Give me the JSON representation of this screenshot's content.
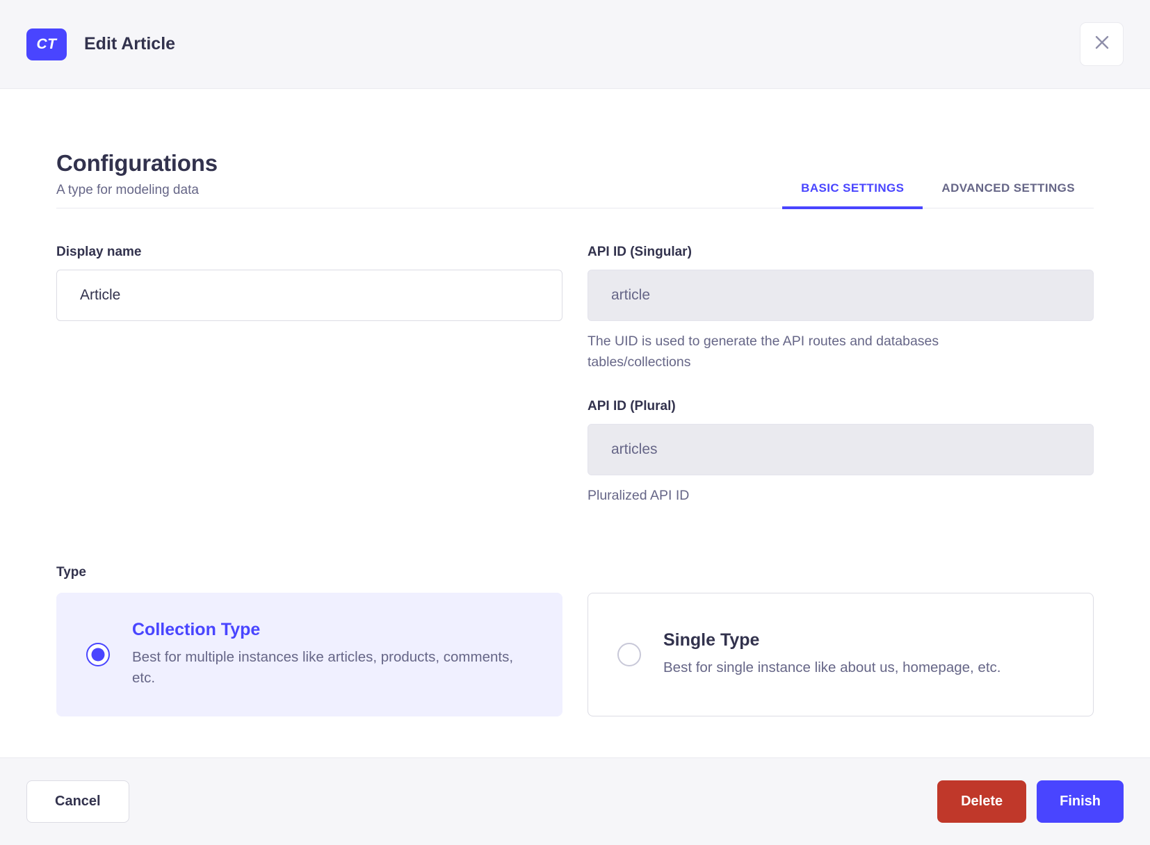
{
  "header": {
    "badge": "CT",
    "title": "Edit Article"
  },
  "section": {
    "title": "Configurations",
    "subtitle": "A type for modeling data"
  },
  "tabs": [
    {
      "label": "BASIC SETTINGS",
      "active": true
    },
    {
      "label": "ADVANCED SETTINGS",
      "active": false
    }
  ],
  "fields": {
    "display_name": {
      "label": "Display name",
      "value": "Article"
    },
    "api_id_singular": {
      "label": "API ID (Singular)",
      "value": "article",
      "hint": "The UID is used to generate the API routes and databases tables/collections",
      "disabled": true
    },
    "api_id_plural": {
      "label": "API ID (Plural)",
      "value": "articles",
      "hint": "Pluralized API ID",
      "disabled": true
    }
  },
  "type_section": {
    "label": "Type",
    "options": [
      {
        "title": "Collection Type",
        "description": "Best for multiple instances like articles, products, comments, etc.",
        "selected": true
      },
      {
        "title": "Single Type",
        "description": "Best for single instance like about us, homepage, etc.",
        "selected": false
      }
    ]
  },
  "footer": {
    "cancel_label": "Cancel",
    "delete_label": "Delete",
    "finish_label": "Finish"
  },
  "colors": {
    "primary": "#4945ff",
    "primary_light_bg": "#f0f0ff",
    "danger": "#c0382a",
    "text": "#32324d",
    "subtle_text": "#666687",
    "border": "#dcdce4",
    "neutral_bg": "#f6f6f9",
    "disabled_input_bg": "#eaeaef"
  }
}
